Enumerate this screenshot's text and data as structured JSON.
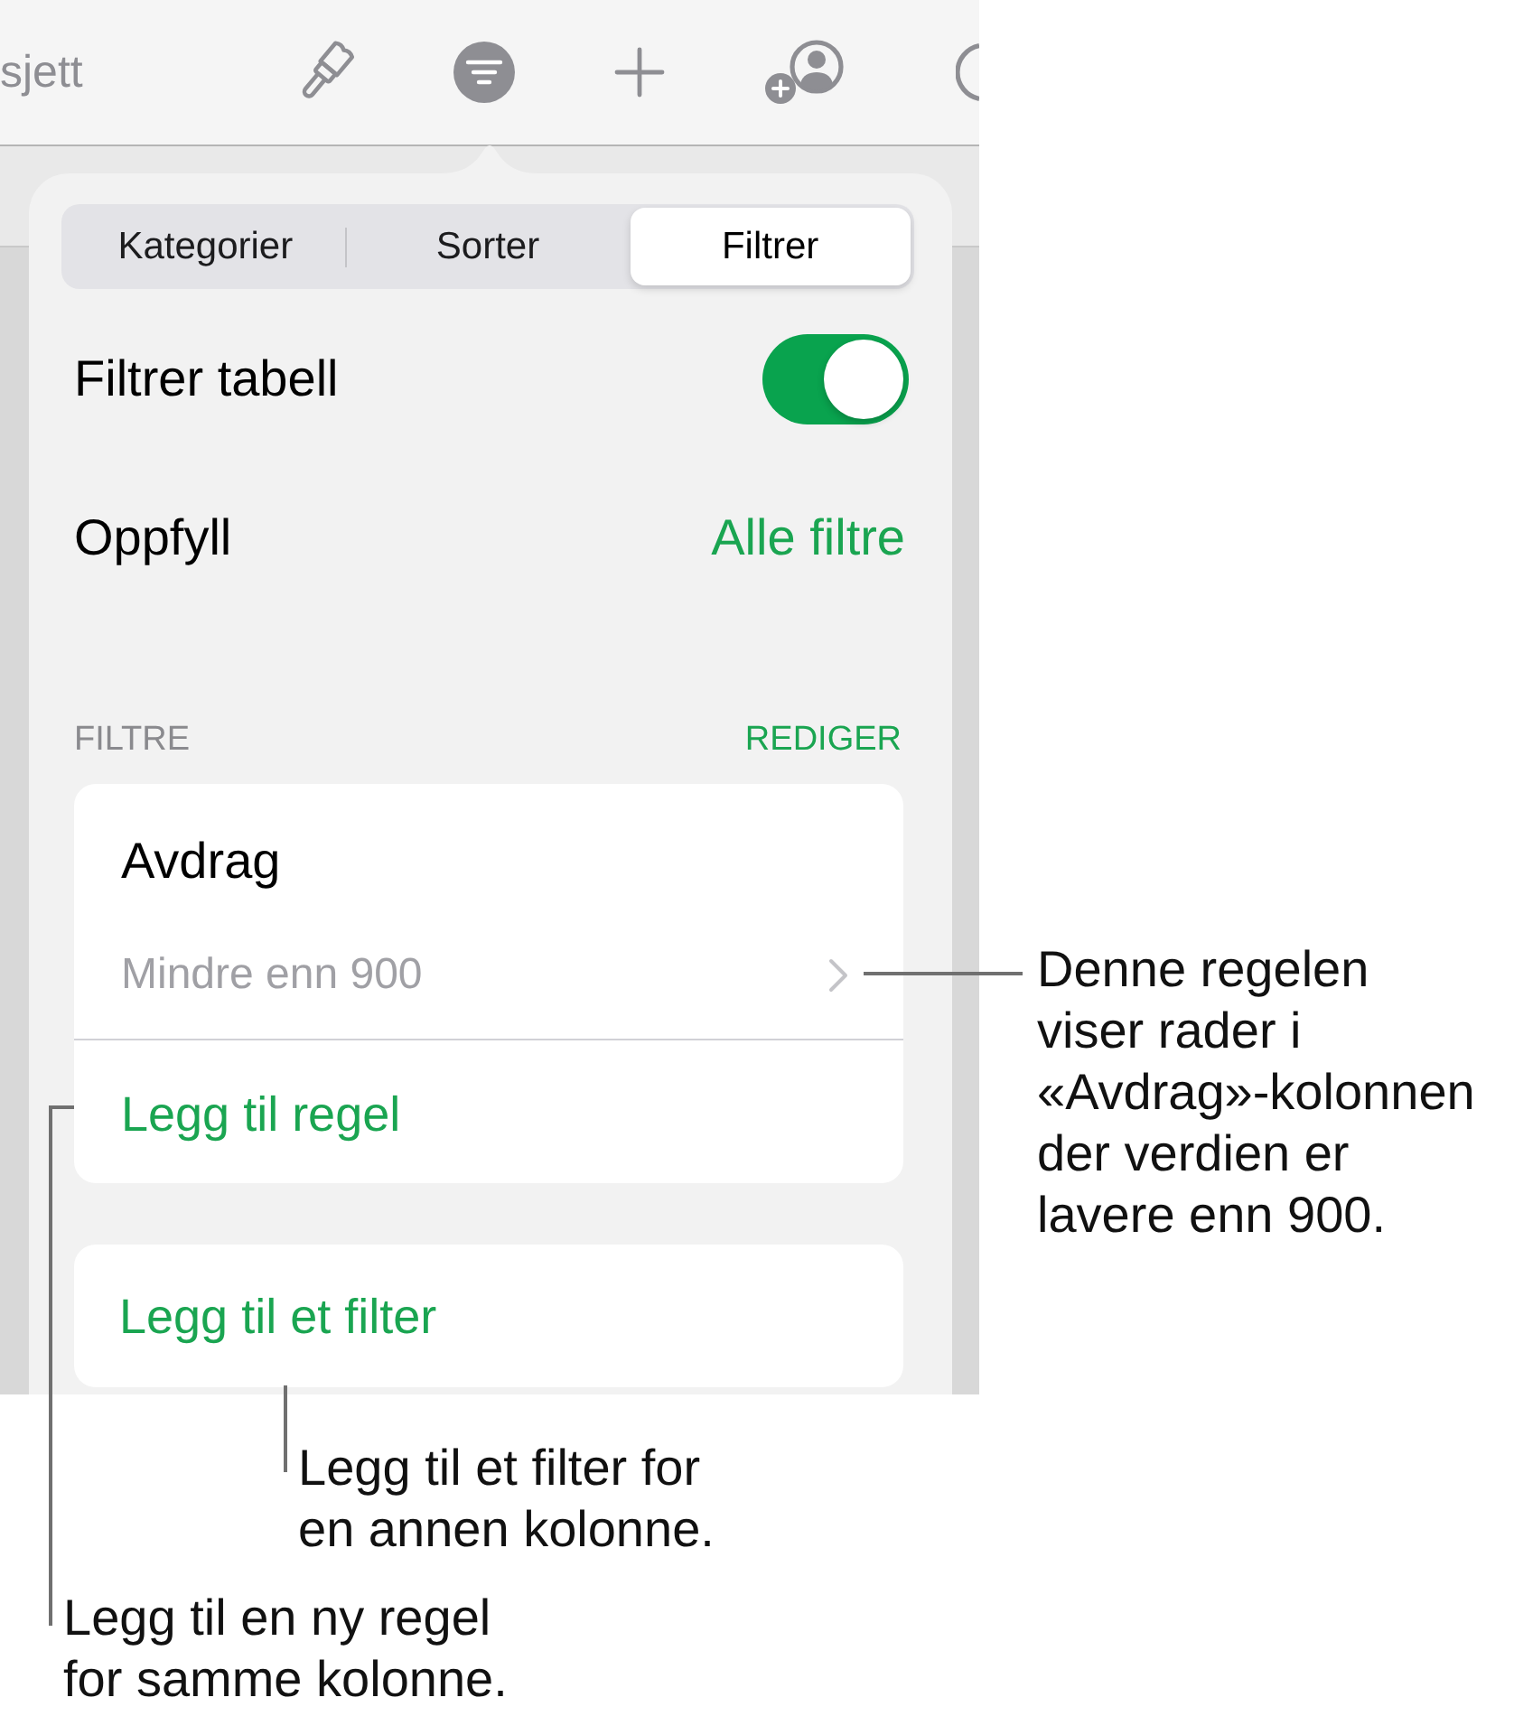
{
  "toolbar": {
    "label": "sjett"
  },
  "segments": [
    {
      "label": "Kategorier",
      "selected": false
    },
    {
      "label": "Sorter",
      "selected": false
    },
    {
      "label": "Filtrer",
      "selected": true
    }
  ],
  "filter_table": {
    "label": "Filtrer tabell",
    "on": true
  },
  "match": {
    "label": "Oppfyll",
    "value": "Alle filtre"
  },
  "filters_section": {
    "header": "FILTRE",
    "action": "REDIGER"
  },
  "filters": [
    {
      "column": "Avdrag",
      "rules": [
        {
          "text": "Mindre enn 900"
        }
      ],
      "add_rule": "Legg til regel"
    }
  ],
  "add_filter": "Legg til et filter",
  "callouts": [
    {
      "lines": [
        "Denne regelen",
        "viser rader i",
        "«Avdrag»-kolonnen",
        "der verdien er",
        "lavere enn 900."
      ]
    },
    {
      "lines": [
        "Legg til et filter for",
        "en annen kolonne."
      ]
    },
    {
      "lines": [
        "Legg til en ny regel",
        "for samme kolonne."
      ]
    }
  ]
}
